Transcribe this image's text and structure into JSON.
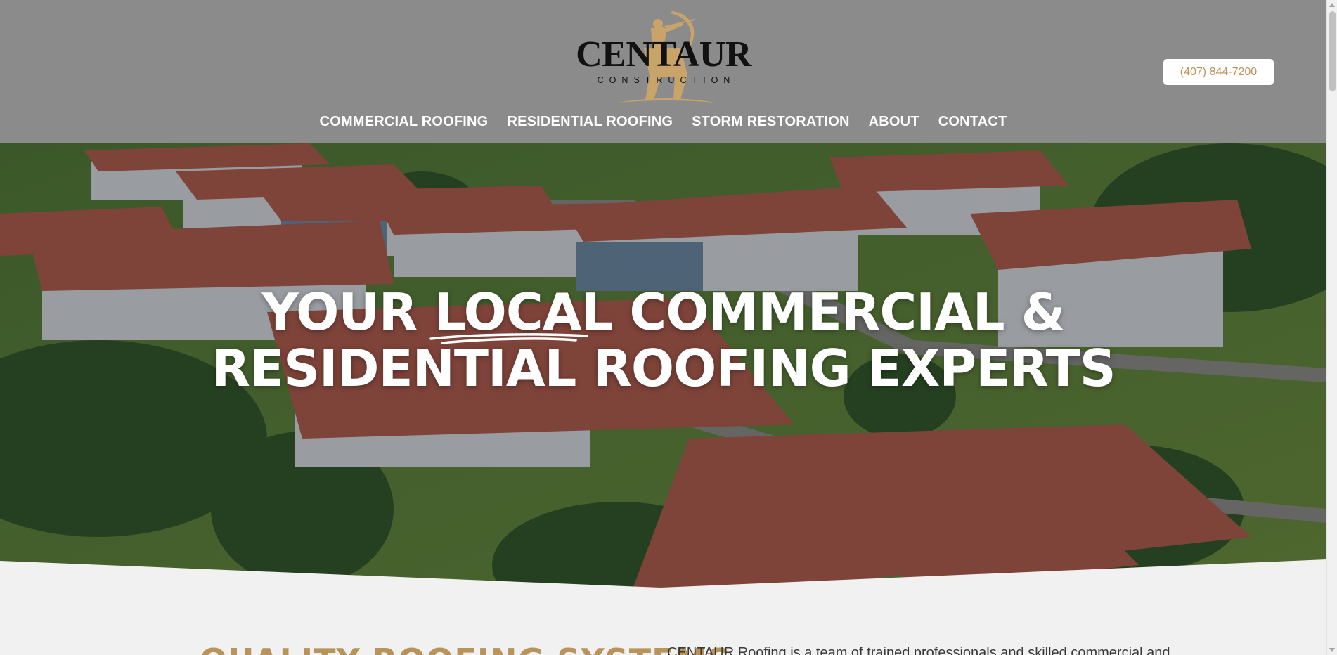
{
  "header": {
    "logo_name": "CENTAUR",
    "logo_sub": "CONSTRUCTION",
    "phone_label": "(407) 844-7200"
  },
  "nav": {
    "items": [
      {
        "label": "COMMERCIAL ROOFING"
      },
      {
        "label": "RESIDENTIAL ROOFING"
      },
      {
        "label": "STORM RESTORATION"
      },
      {
        "label": "ABOUT"
      },
      {
        "label": "CONTACT"
      }
    ]
  },
  "hero": {
    "line1_start": "YOUR",
    "line1_local": "LOCAL",
    "line1_end": "COMMERCIAL &",
    "line2": "RESIDENTIAL ROOFING EXPERTS"
  },
  "section": {
    "heading": "QUALITY ROOFING SYSTEMS",
    "text": "CENTAUR Roofing is a team of trained professionals and skilled commercial and"
  },
  "colors": {
    "header_bg": "#8b8b8b",
    "accent_gold": "#b8945a",
    "page_bg": "#f1f1f1"
  },
  "icons": {
    "logo": "centaur-archer-logo"
  }
}
